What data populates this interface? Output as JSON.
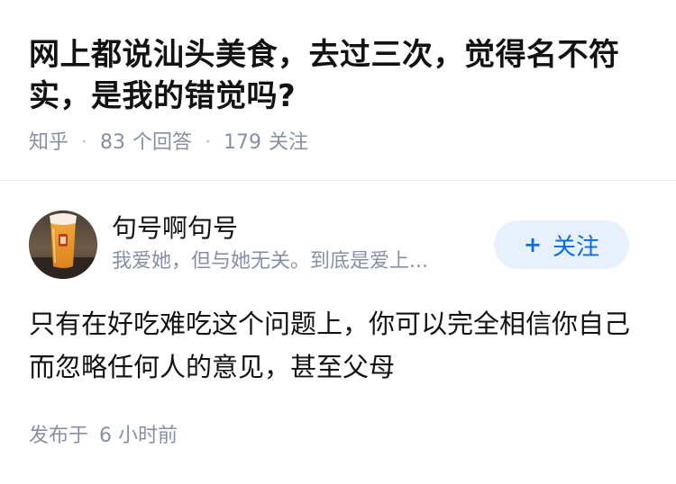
{
  "question": {
    "title": "网上都说汕头美食，去过三次，觉得名不符实，是我的错觉吗?",
    "source": "知乎",
    "answers_count": "83",
    "answers_label": "个回答",
    "followers_count": "179",
    "followers_label": "关注"
  },
  "author": {
    "name": "句号啊句号",
    "bio": "我爱她，但与她无关。到底是爱上...",
    "avatar_icon": "avatar-beer-glass-photo",
    "follow_label": "关注",
    "follow_icon": "plus-icon"
  },
  "answer": {
    "text": "只有在好吃难吃这个问题上，你可以完全相信你自己而忽略任何人的意见，甚至父母",
    "published_label": "发布于",
    "published_time": "6 小时前"
  },
  "colors": {
    "text_primary": "#121212",
    "text_secondary": "#8590a6",
    "brand_blue": "#056de8",
    "follow_bg": "#e8f0fb",
    "divider": "#ebebeb"
  }
}
